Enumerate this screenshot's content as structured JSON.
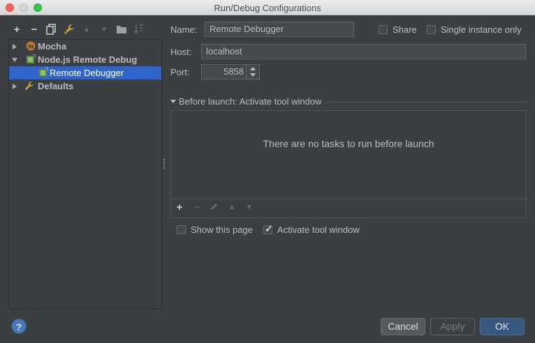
{
  "window": {
    "title": "Run/Debug Configurations"
  },
  "toolbar": {
    "add": "+",
    "remove": "−",
    "move_up": "▲",
    "move_down": "▼"
  },
  "tree": {
    "items": [
      {
        "label": "Mocha",
        "icon": "mocha-icon"
      },
      {
        "label": "Node.js Remote Debug",
        "icon": "nodejs-remote-debug-icon"
      },
      {
        "label": "Remote Debugger",
        "icon": "remote-debugger-icon"
      },
      {
        "label": "Defaults",
        "icon": "wrench-icon"
      }
    ]
  },
  "form": {
    "name_label": "Name:",
    "name_value": "Remote Debugger",
    "share_label": "Share",
    "share_checked": false,
    "single_instance_label": "Single instance only",
    "single_instance_checked": false,
    "host_label": "Host:",
    "host_value": "localhost",
    "port_label": "Port:",
    "port_value": "5858"
  },
  "before_launch": {
    "title": "Before launch: Activate tool window",
    "empty_text": "There are no tasks to run before launch",
    "add": "+",
    "remove": "−",
    "move_up": "▲",
    "move_down": "▼"
  },
  "options": {
    "show_page_label": "Show this page",
    "show_page_checked": false,
    "activate_label": "Activate tool window",
    "activate_checked": true
  },
  "footer": {
    "help": "?",
    "cancel": "Cancel",
    "apply": "Apply",
    "ok": "OK"
  },
  "colors": {
    "background": "#3c3f41",
    "selection": "#2f65ca",
    "primary_button": "#365880"
  }
}
